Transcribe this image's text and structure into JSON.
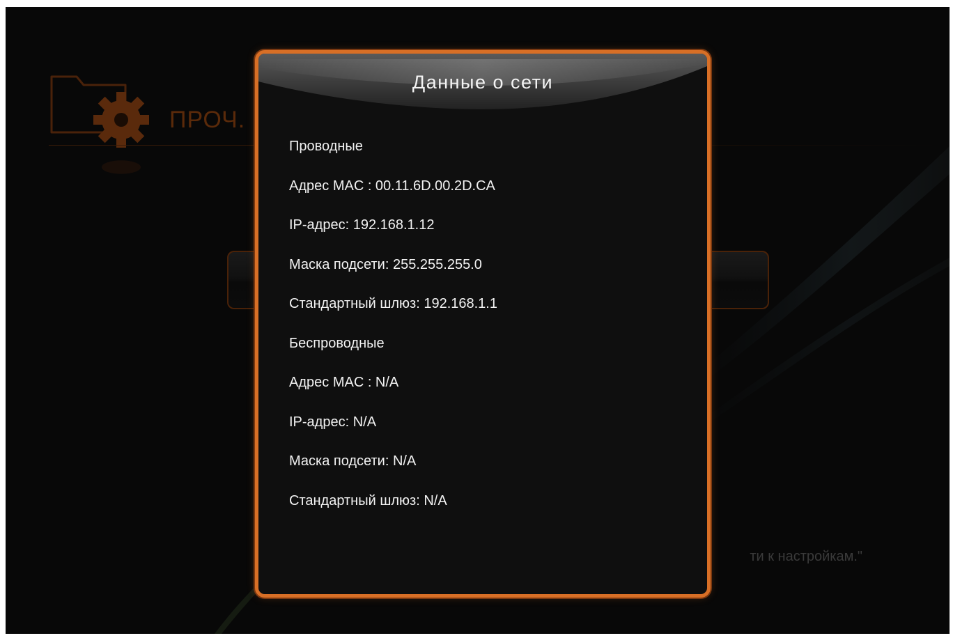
{
  "background": {
    "section_title": "ПРОЧ.",
    "hint_text": "ти к настройкам.\""
  },
  "dialog": {
    "title": "Данные о сети",
    "rows": [
      "Проводные",
      "Адрес MAC : 00.11.6D.00.2D.CA",
      "IP-адрес: 192.168.1.12",
      "Маска подсети: 255.255.255.0",
      "Стандартный шлюз: 192.168.1.1",
      "Беспроводные",
      "Адрес MAC : N/A",
      "IP-адрес: N/A",
      "Маска подсети: N/A",
      "Стандартный шлюз: N/A"
    ]
  },
  "colors": {
    "accent_orange": "#d86f26",
    "screen_bg": "#080808",
    "dialog_bg": "#0f0f0f",
    "text": "#f2f2f2"
  },
  "icons": {
    "section": "folder-gear-icon"
  }
}
